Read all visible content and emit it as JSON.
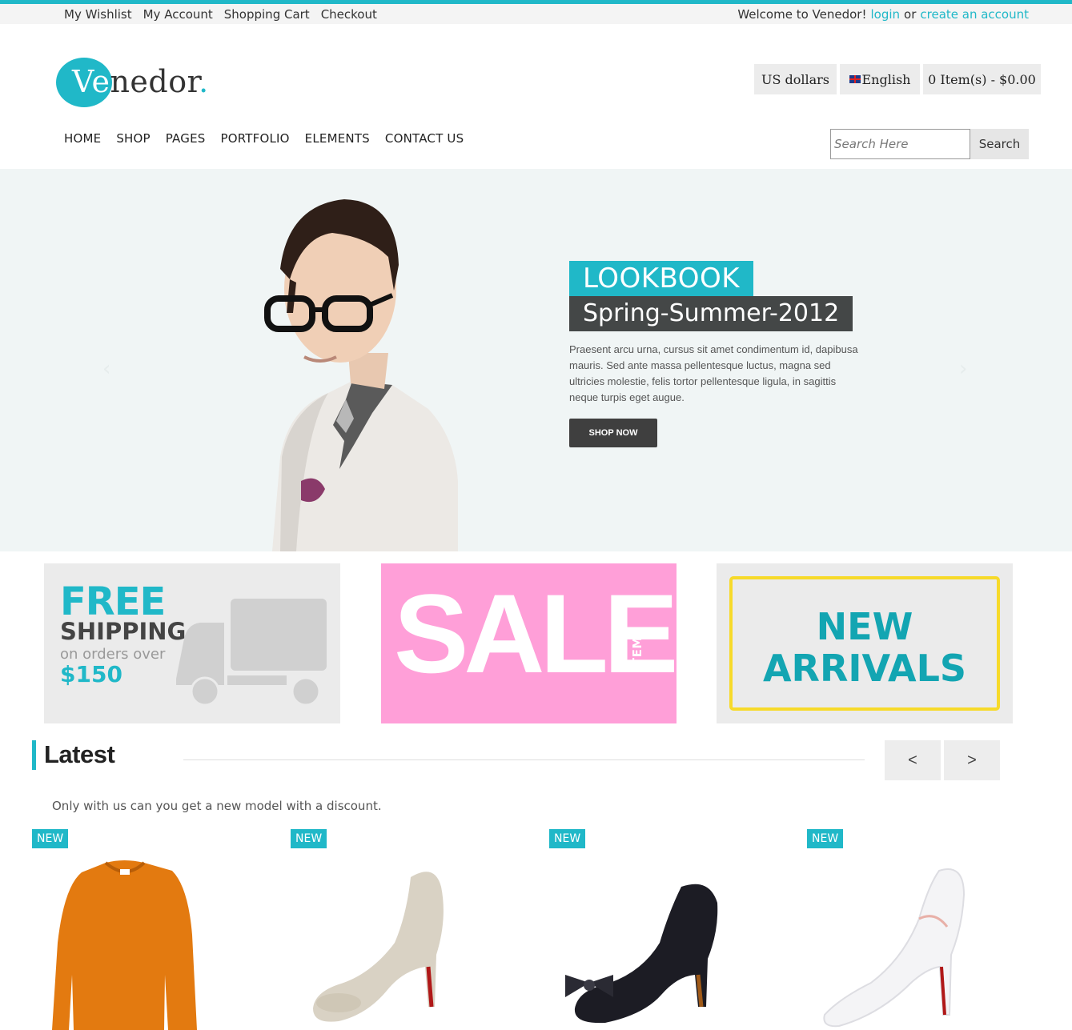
{
  "topbar": {
    "links": [
      "My Wishlist",
      "My Account",
      "Shopping Cart",
      "Checkout"
    ],
    "welcome": "Welcome to Venedor!",
    "login": "login",
    "or": "or",
    "create_account": "create an account"
  },
  "logo": {
    "prefix": "Ve",
    "rest": "nedor",
    "dot": "."
  },
  "header": {
    "currency": "US dollars",
    "language": "English",
    "cart": "0 Item(s) - $0.00"
  },
  "nav": [
    "HOME",
    "SHOP",
    "PAGES",
    "PORTFOLIO",
    "ELEMENTS",
    "CONTACT US"
  ],
  "search": {
    "placeholder": "Search Here",
    "button": "Search"
  },
  "hero": {
    "title": "LOOKBOOK",
    "subtitle": "Spring-Summer-2012",
    "description": "Praesent arcu urna, cursus sit amet condimentum id, dapibusa mauris. Sed ante massa pellentesque luctus, magna sed ultricies molestie, felis tortor pellentesque ligula, in sagittis neque turpis eget augue.",
    "button": "SHOP NOW",
    "prev_arrow": "‹",
    "next_arrow": "›"
  },
  "banners": {
    "shipping": {
      "free": "FREE",
      "shipping": "SHIPPING",
      "orders": "on orders over",
      "price": "$150"
    },
    "sale": {
      "text": "SALE",
      "many": "MANY ITEMS"
    },
    "arrivals": {
      "line1": "NEW",
      "line2": "ARRIVALS"
    }
  },
  "latest": {
    "title": "Latest",
    "description": "Only with us can you get a new model with a discount.",
    "prev": "<",
    "next": ">",
    "products": [
      {
        "badge": "NEW",
        "image": "orange-sweater"
      },
      {
        "badge": "NEW",
        "image": "glitter-heel"
      },
      {
        "badge": "NEW",
        "image": "black-bow-heel"
      },
      {
        "badge": "NEW",
        "image": "white-stiletto"
      }
    ]
  },
  "colors": {
    "accent": "#20b8c8",
    "sale_pink": "#ff9fd8",
    "frame_yellow": "#f7da2a",
    "dark_button": "#3f3f3f"
  }
}
